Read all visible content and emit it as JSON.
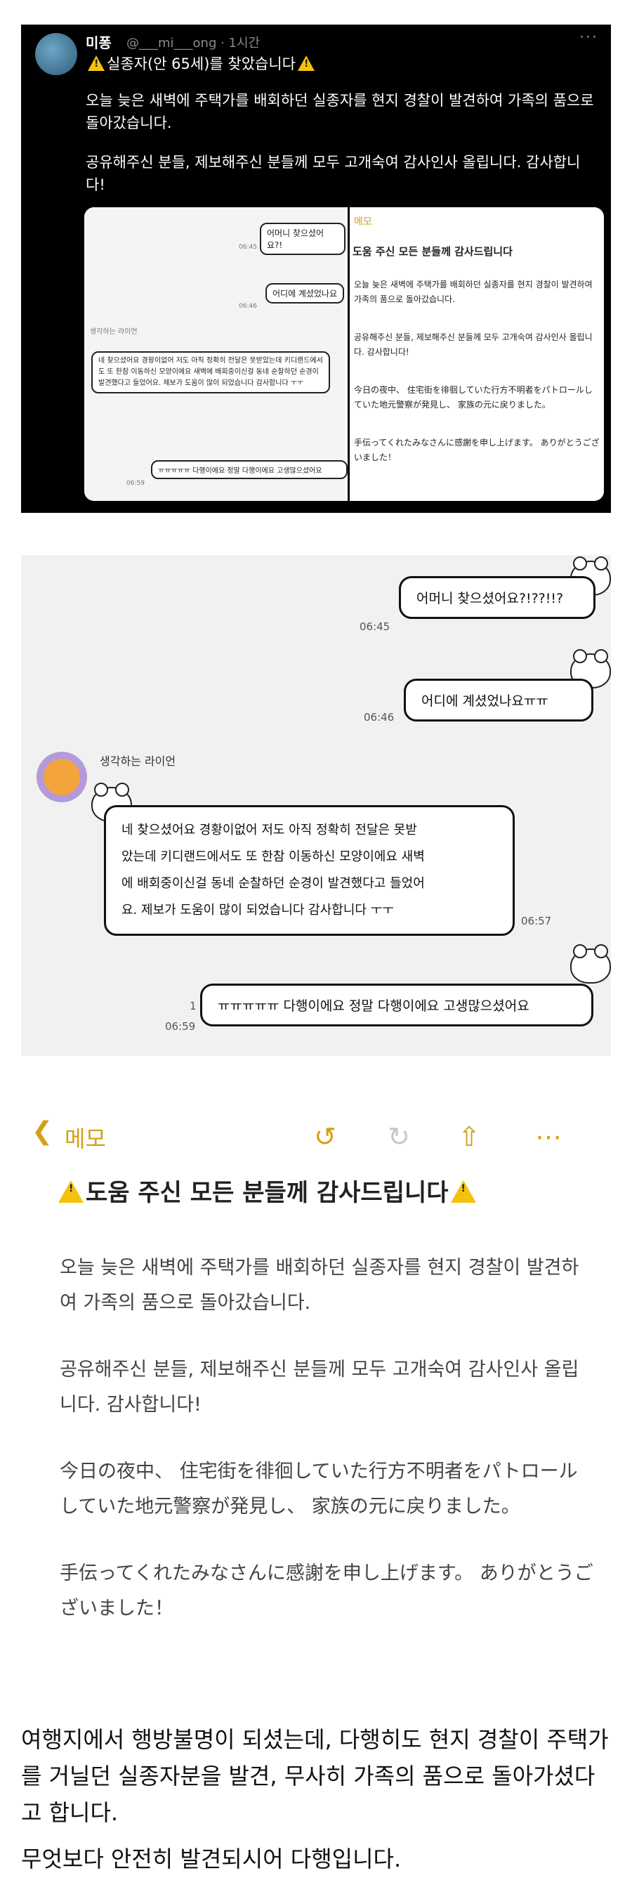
{
  "tweet": {
    "name": "미퐁",
    "handle": "@___mi___ong · 1시간",
    "more": "···",
    "title": "실종자(안 65세)를 찾았습니다",
    "body1": "오늘 늦은 새벽에 주택가를 배회하던 실종자를 현지 경찰이 발견하여 가족의 품으로 돌아갔습니다.",
    "body2": "공유해주신 분들, 제보해주신 분들께 모두 고개숙여 감사인사 올립니다. 감사합니다!",
    "mini_chat": [
      {
        "text": "어머니 찾으셨어요?!",
        "time": "06:45"
      },
      {
        "text": "어디에 계셨었나요",
        "time": "06:46"
      },
      {
        "sender": "생각하는 라이언",
        "text": "네 찾으셨어요 경황이없어 저도 아직 정확히 전달은 못받았는데 키디랜드에서도 또 한참 이동하신 모양이에요 새벽에 배회중이신걸 동네 순찰하던 순경이 발견했다고 들었어요. 제보가 도움이 많이 되었습니다 감사합니다 ㅜㅜ"
      },
      {
        "text": "ㅠㅠㅠㅠㅠ 다행이에요 정말 다행이에요 고생많으셨어요",
        "time": "06:59"
      }
    ],
    "mini_memo": {
      "back": "메모",
      "title": "도움 주신 모든 분들께 감사드립니다",
      "p1": "오늘 늦은 새벽에 주택가를 배회하던 실종자를 현지 경찰이 발견하여 가족의 품으로 돌아갔습니다.",
      "p2": "공유해주신 분들, 제보해주신 분들께 모두 고개숙여 감사인사 올립니다. 감사합니다!",
      "p3": "今日の夜中、 住宅街を徘徊していた行方不明者をパトロールしていた地元警察が発見し、 家族の元に戻りました。",
      "p4": "手伝ってくれたみなさんに感謝を申し上げます。 ありがとうございました！"
    }
  },
  "chat": {
    "msg1": {
      "text": "어머니 찾으셨어요?!??!!?",
      "time": "06:45"
    },
    "msg2": {
      "text": "어디에 계셨었나요ㅠㅠ",
      "time": "06:46"
    },
    "sender": "생각하는 라이언",
    "msg3": {
      "lines": [
        "네 찾으셨어요 경황이없어 저도 아직 정확히 전달은 못받",
        "았는데 키디랜드에서도 또 한참 이동하신 모양이에요 새벽",
        "에 배회중이신걸 동네 순찰하던 순경이 발견했다고 들었어",
        "요. 제보가 도움이 많이 되었습니다 감사합니다 ㅜㅜ"
      ],
      "time": "06:57"
    },
    "msg4": {
      "text": "ㅠㅠㅠㅠㅠ 다행이에요 정말 다행이에요 고생많으셨어요",
      "time": "06:59",
      "unread": "1"
    }
  },
  "memo": {
    "back_label": "메모",
    "title": "도움 주신 모든 분들께 감사드립니다",
    "p1": "오늘 늦은 새벽에 주택가를 배회하던 실종자를 현지 경찰이 발견하여 가족의 품으로 돌아갔습니다.",
    "p2": "공유해주신 분들, 제보해주신 분들께 모두 고개숙여 감사인사 올립니다. 감사합니다!",
    "p3": "今日の夜中、 住宅街を徘徊していた行方不明者をパトロールしていた地元警察が発見し、 家族の元に戻りました。",
    "p4": "手伝ってくれたみなさんに感謝を申し上げます。 ありがとうございました！"
  },
  "footer": {
    "p1": "여행지에서 행방불명이 되셨는데, 다행히도 현지 경찰이 주택가를 거닐던 실종자분을 발견, 무사히 가족의 품으로 돌아가셨다고 합니다.",
    "p2": "무엇보다 안전히 발견되시어 다행입니다."
  },
  "colors": {
    "accent": "#d4a017",
    "warning": "#f4c20d",
    "tweet_bg": "#000000",
    "chat_bg": "#f1f1f1"
  }
}
